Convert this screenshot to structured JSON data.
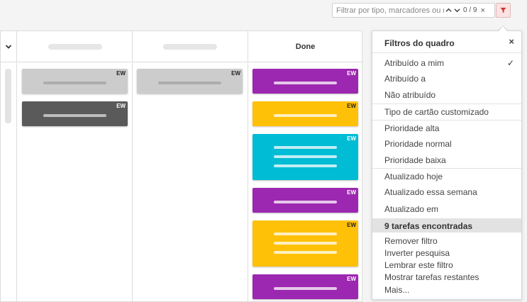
{
  "search": {
    "placeholder": "Filtrar por tipo, marcadores ou n",
    "count": "0 / 9",
    "clear": "×"
  },
  "board": {
    "columns": [
      {
        "title": ""
      },
      {
        "title": ""
      },
      {
        "title": "Done"
      }
    ],
    "cards": [
      {
        "column": 1,
        "color": "#cccccc",
        "label": "EW",
        "label_color": "#222222",
        "lines": 1
      },
      {
        "column": 1,
        "color": "#5a5a5a",
        "label": "EW",
        "label_color": "#ffffff",
        "lines": 1
      },
      {
        "column": 2,
        "color": "#cccccc",
        "label": "EW",
        "label_color": "#222222",
        "lines": 1
      },
      {
        "column": 3,
        "color": "#9c27b0",
        "label": "EW",
        "label_color": "#ffffff",
        "lines": 1
      },
      {
        "column": 3,
        "color": "#ffc107",
        "label": "EW",
        "label_color": "#222222",
        "lines": 1
      },
      {
        "column": 3,
        "color": "#00bcd4",
        "label": "EW",
        "label_color": "#ffffff",
        "lines": 3
      },
      {
        "column": 3,
        "color": "#9c27b0",
        "label": "EW",
        "label_color": "#ffffff",
        "lines": 1
      },
      {
        "column": 3,
        "color": "#ffc107",
        "label": "EW",
        "label_color": "#222222",
        "lines": 3
      },
      {
        "column": 3,
        "color": "#9c27b0",
        "label": "EW",
        "label_color": "#ffffff",
        "lines": 1
      }
    ]
  },
  "filter_panel": {
    "title": "Filtros do quadro",
    "close": "×",
    "items": [
      {
        "label": "Atribuído a mim",
        "checked": true,
        "check_glyph": "✓"
      },
      {
        "label": "Atribuído a",
        "checked": false
      },
      {
        "label": "Não atribuído",
        "checked": false
      },
      {
        "label": "Tipo de cartão customizado",
        "checked": false
      },
      {
        "label": "Prioridade alta",
        "checked": false
      },
      {
        "label": "Prioridade normal",
        "checked": false
      },
      {
        "label": "Prioridade baixa",
        "checked": false
      },
      {
        "label": "Atualizado hoje",
        "checked": false
      },
      {
        "label": "Atualizado essa semana",
        "checked": false
      },
      {
        "label": "Atualizado em",
        "checked": false
      }
    ],
    "results": "9 tarefas encontradas",
    "actions": [
      "Remover filtro",
      "Inverter pesquisa",
      "Lembrar este filtro",
      "Mostrar tarefas restantes",
      "Mais..."
    ]
  },
  "colors": {
    "filter_accent": "#d32f2f"
  },
  "icons": {
    "filter": "filter-funnel-icon",
    "prev": "chevron-up-icon",
    "next": "chevron-down-icon",
    "collapse": "chevron-down-icon"
  }
}
